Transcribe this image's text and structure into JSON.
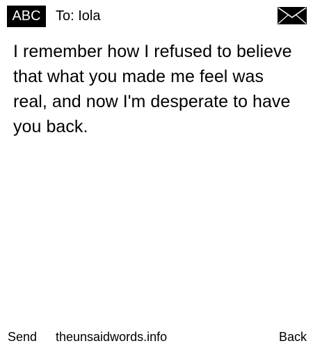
{
  "header": {
    "input_mode": "ABC",
    "recipient": "To: Iola",
    "message_icon": "envelope-icon"
  },
  "message": {
    "text": "I remember how I refused to believe that what you made me feel was real, and now I'm desperate to have you back."
  },
  "footer": {
    "send_label": "Send",
    "site_label": "theunsaidwords.info",
    "back_label": "Back"
  },
  "colors": {
    "background": "#ffffff",
    "text": "#000000",
    "badge_background": "#000000",
    "badge_text": "#ffffff"
  }
}
